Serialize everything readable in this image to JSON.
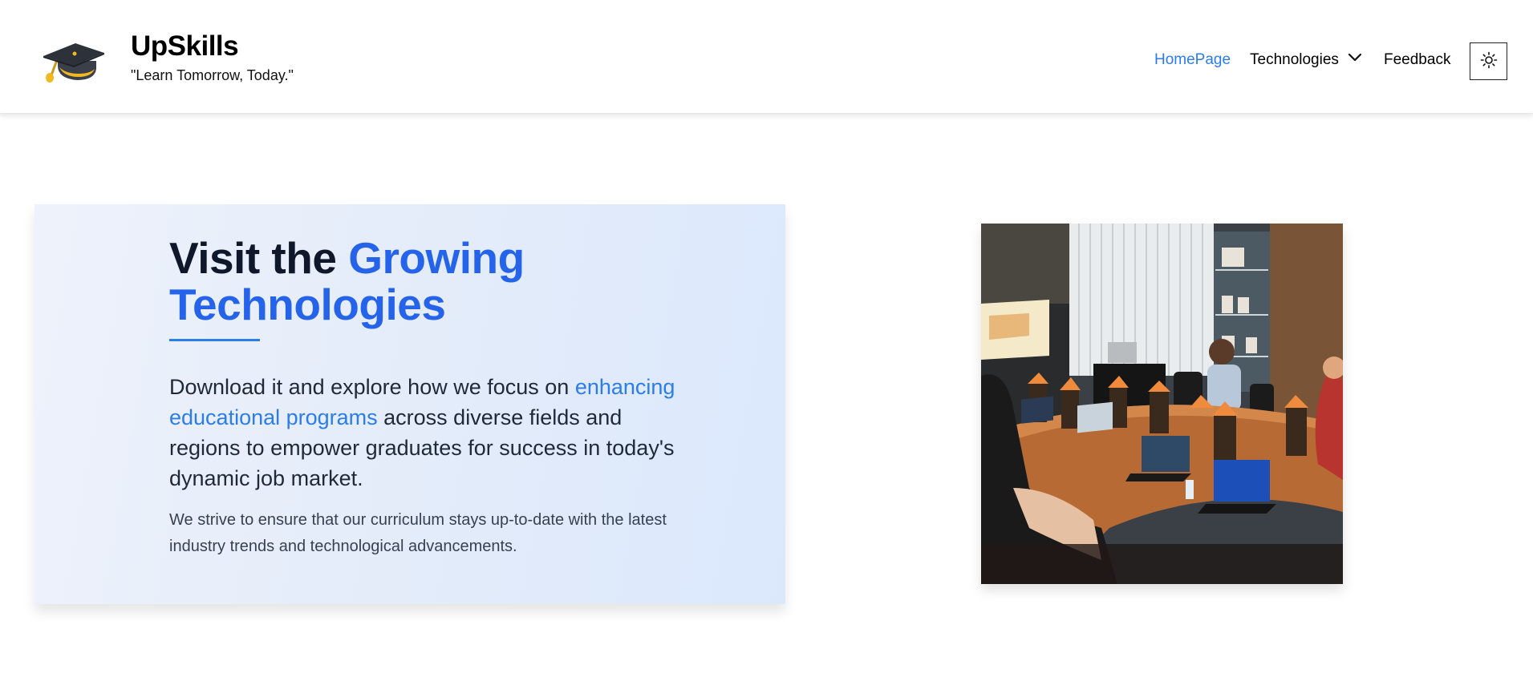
{
  "header": {
    "brand_name": "UpSkills",
    "tagline": "\"Learn Tomorrow, Today.\"",
    "logo_icon": "graduation-cap-icon",
    "nav": [
      {
        "label": "HomePage",
        "active": true
      },
      {
        "label": "Technologies",
        "icon": "chevron-down-icon"
      },
      {
        "label": "Feedback"
      }
    ],
    "theme_toggle_icon": "sun-icon"
  },
  "hero": {
    "title_part1": "Visit the ",
    "title_accent_line1": "Growing",
    "title_accent_line2": "Technologies",
    "lead_before": "Download it and explore how we focus on ",
    "lead_highlight": "enhancing educational programs",
    "lead_after": " across diverse fields and regions to empower graduates for success in today's dynamic job market.",
    "note": "We strive to ensure that our curriculum stays up-to-date with the latest industry trends and technological advancements."
  },
  "photo": {
    "subject": "meeting-room-laptops-photo"
  },
  "colors": {
    "accent": "#2563eb",
    "link": "#2b7de9",
    "text_dark": "#0f172a",
    "card_bg_start": "#eef2fb",
    "card_bg_end": "#dbe8fc"
  }
}
